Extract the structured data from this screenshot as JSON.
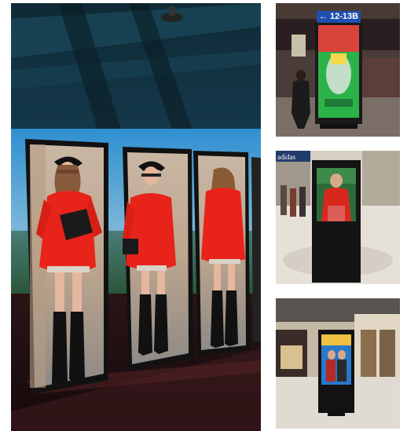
{
  "images": {
    "main_photo": {
      "subject": "three-led-poster-screens-showing-model-in-red-coat"
    },
    "photo_top_right": {
      "subject": "standing-digital-signage-in-station",
      "sign_text": "← 12-13B"
    },
    "photo_middle_right": {
      "subject": "digital-kiosk-in-shopping-mall",
      "brand_text": "adidas"
    },
    "photo_bottom_right": {
      "subject": "digital-poster-in-mall-atrium"
    }
  },
  "colors": {
    "coat": "#e8231a",
    "boots": "#111111",
    "sign_bg": "#1f4fb0"
  }
}
